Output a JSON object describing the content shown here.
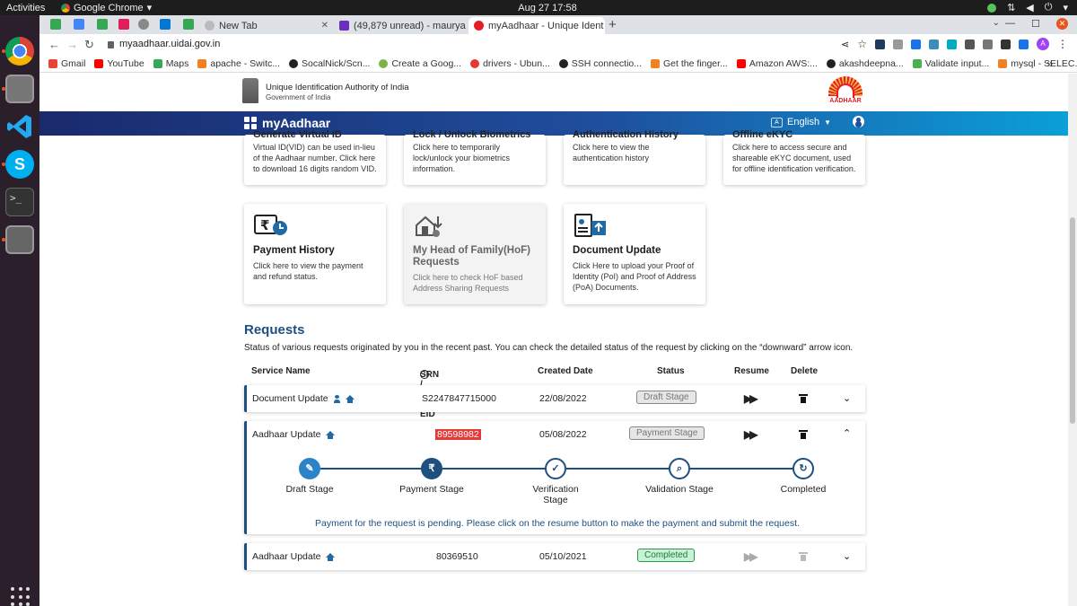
{
  "topbar": {
    "activities": "Activities",
    "app_name": "Google Chrome",
    "datetime": "Aug 27  17:58"
  },
  "tabs": [
    {
      "label": "New Tab",
      "active": false
    },
    {
      "label": "(49,879 unread) - maurya",
      "active": false
    },
    {
      "label": "myAadhaar - Unique Ident",
      "active": true
    }
  ],
  "toolbar": {
    "url": "myaadhaar.uidai.gov.in",
    "avatar_letter": "A"
  },
  "bookmarks": [
    "Gmail",
    "YouTube",
    "Maps",
    "apache - Switc...",
    "SocalNick/Scn...",
    "Create a Goog...",
    "drivers - Ubun...",
    "SSH connectio...",
    "Get the finger...",
    "Amazon AWS:...",
    "akashdeepna...",
    "Validate input...",
    "mysql - SELEC..."
  ],
  "header": {
    "org_name": "Unique Identification Authority of India",
    "org_sub": "Government of India",
    "logo_text": "AADHAAR"
  },
  "navbar": {
    "brand": "myAadhaar",
    "language": "English"
  },
  "cards_top": [
    {
      "title": "Generate Virtual ID",
      "desc": "Virtual ID(VID) can be used in-lieu of the Aadhaar number. Click here to download 16 digits random VID."
    },
    {
      "title": "Lock / Unlock Biometrics",
      "desc": "Click here to temporarily lock/unlock your biometrics information."
    },
    {
      "title": "Authentication History",
      "desc": "Click here to view the authentication history"
    },
    {
      "title": "Offline eKYC",
      "desc": "Click here to access secure and shareable eKYC document, used for offline identification verification."
    }
  ],
  "cards_bottom": [
    {
      "title": "Payment History",
      "desc": "Click here to view the payment and refund status."
    },
    {
      "title": "My Head of Family(HoF) Requests",
      "desc": "Click here to check HoF based Address Sharing Requests"
    },
    {
      "title": "Document Update",
      "desc": "Click Here to upload your Proof of Identity (PoI) and Proof of Address (PoA) Documents."
    }
  ],
  "requests": {
    "title": "Requests",
    "subtitle": "Status of various requests originated by you in the recent past. You can check the detailed status of the request by clicking on the “downward” arrow icon.",
    "columns": [
      "Service Name",
      "SRN / URN / EID",
      "Created Date",
      "Status",
      "Resume",
      "Delete"
    ],
    "rows": [
      {
        "service": "Document Update",
        "srn": "S2247847715000",
        "date": "22/08/2022",
        "status": "Draft Stage"
      },
      {
        "service": "Aadhaar Update",
        "srn": "89598982",
        "date": "05/08/2022",
        "status": "Payment Stage"
      },
      {
        "service": "Aadhaar Update",
        "srn": "80369510",
        "date": "05/10/2021",
        "status": "Completed"
      }
    ],
    "steps": [
      "Draft Stage",
      "Payment Stage",
      "Verification Stage",
      "Validation Stage",
      "Completed"
    ],
    "pending_message": "Payment for the request is pending. Please click on the resume button to make the payment and submit the request."
  },
  "colors": {
    "primary": "#1f4f7e",
    "navbar_start": "#1a2a6c",
    "navbar_end": "#0aa0d8",
    "completed_green": "#2b9a4f",
    "highlight_red": "#e53935"
  }
}
